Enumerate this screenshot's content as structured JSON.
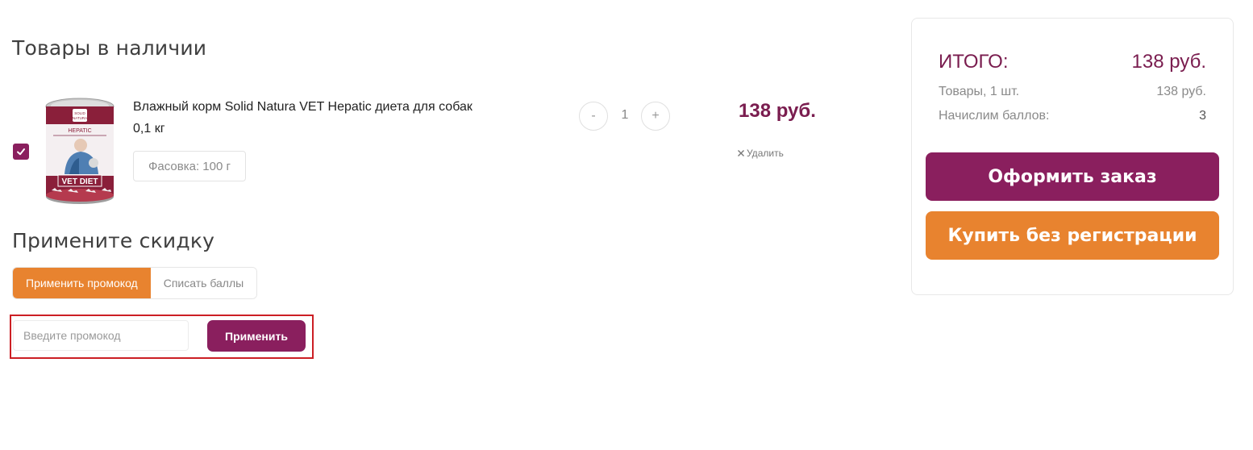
{
  "sections": {
    "available_title": "Товары в наличии",
    "discount_title": "Примените скидку"
  },
  "product": {
    "checked": true,
    "name": "Влажный корм Solid Natura VET Hepatic диета для собак",
    "weight": "0,1 кг",
    "variant": "Фасовка: 100 г",
    "quantity": "1",
    "qty_minus": "-",
    "qty_plus": "+",
    "price": "138 руб.",
    "delete_label": "Удалить",
    "image_labels": {
      "brand": "SOLID NATURA",
      "line": "HEPATIC",
      "series": "VET DIET"
    }
  },
  "discount": {
    "tabs": [
      {
        "label": "Применить промокод",
        "active": true
      },
      {
        "label": "Списать баллы",
        "active": false
      }
    ],
    "promo_placeholder": "Введите промокод",
    "apply_label": "Применить"
  },
  "summary": {
    "total_label": "ИТОГО:",
    "total_value": "138 руб.",
    "items_label": "Товары, 1 шт.",
    "items_value": "138 руб.",
    "points_label": "Начислим баллов:",
    "points_value": "3",
    "checkout_label": "Оформить заказ",
    "guest_label": "Купить без регистрации"
  },
  "colors": {
    "brand_purple": "#8a1f5e",
    "accent_orange": "#e8832f",
    "highlight_red": "#cc1f24"
  },
  "icons": {
    "checkbox": "check-icon",
    "delete": "close-icon"
  }
}
